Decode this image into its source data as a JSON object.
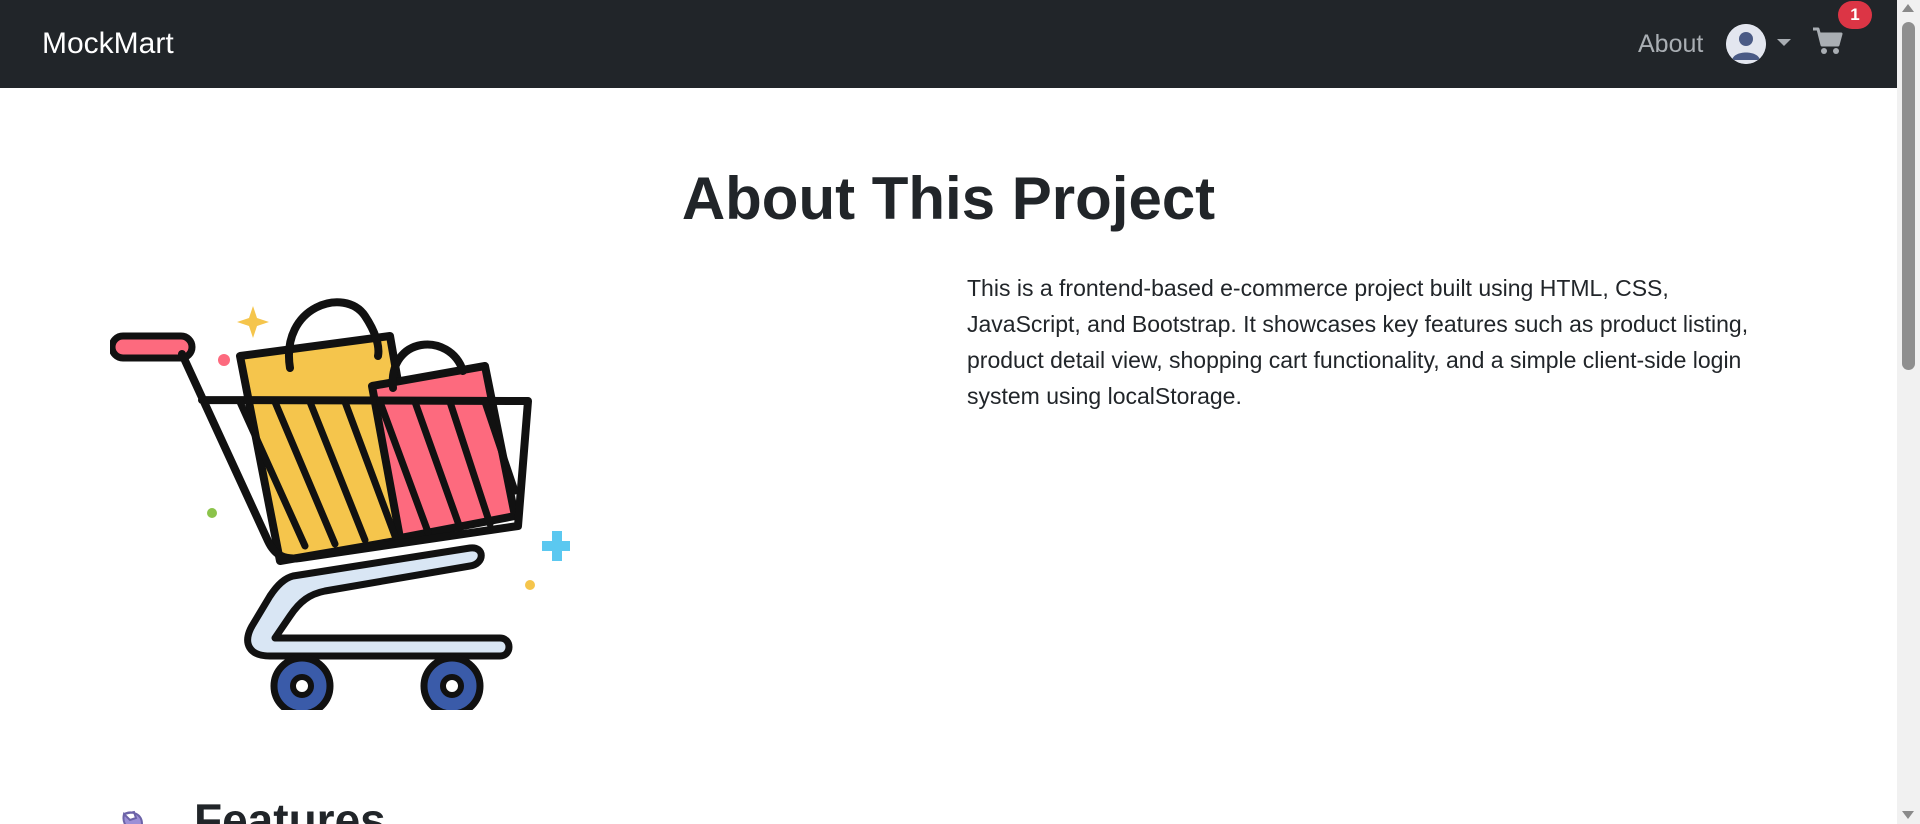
{
  "navbar": {
    "brand": "MockMart",
    "about_link": "About",
    "user_icon": "user-avatar-icon",
    "cart_icon": "shopping-cart-icon",
    "cart_count": "1"
  },
  "main": {
    "title": "About This Project",
    "description": "This is a frontend-based e-commerce project built using HTML, CSS, JavaScript, and Bootstrap. It showcases key features such as product listing, product detail view, shopping cart functionality, and a simple client-side login system using localStorage.",
    "illustration_icon": "shopping-cart-with-bags-illustration",
    "features_heading": "Features",
    "features_icon": "wrench-icon"
  },
  "colors": {
    "navbar_bg": "#212529",
    "badge_bg": "#dc3545",
    "bag_yellow": "#f5c54c",
    "bag_pink": "#fd6a7e",
    "wheel_blue": "#3a5ba9"
  }
}
